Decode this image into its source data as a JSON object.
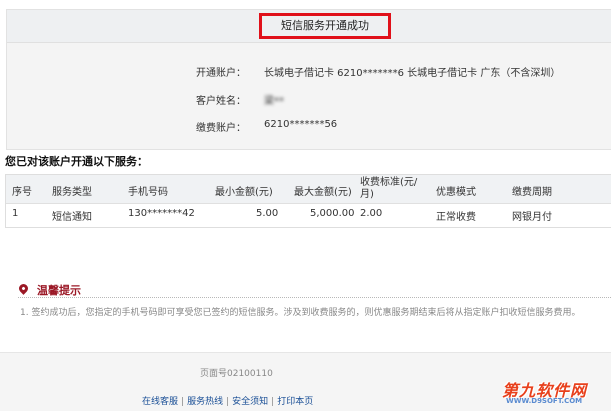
{
  "header": {
    "title": "短信服务开通成功"
  },
  "account_info": {
    "open_account_label": "开通账户：",
    "open_account_value": "长城电子借记卡  6210*******6 长城电子借记卡  广东（不含深圳）",
    "customer_name_label": "客户姓名：",
    "customer_name_value": "梁**",
    "payment_account_label": "缴费账户：",
    "payment_account_value": "6210*******56"
  },
  "services": {
    "heading": "您已对该账户开通以下服务：",
    "columns": [
      "序号",
      "服务类型",
      "手机号码",
      "最小金额(元)",
      "最大金额(元)",
      "收费标准(元/月)",
      "优惠模式",
      "缴费周期"
    ],
    "rows": [
      {
        "index": "1",
        "type": "短信通知",
        "phone": "130*******42",
        "min_amount": "5.00",
        "max_amount": "5,000.00",
        "fee": "2.00",
        "discount": "正常收费",
        "cycle": "网银月付"
      }
    ]
  },
  "tips": {
    "title": "温馨提示",
    "text": "1. 签约成功后，您指定的手机号码即可享受您已签约的短信服务。涉及到收费服务的，则优惠服务期结束后将从指定账户扣收短信服务费用。"
  },
  "footer": {
    "page_number": "页面号02100110",
    "links": [
      "在线客服",
      "服务热线",
      "安全须知",
      "打印本页"
    ]
  },
  "watermark": {
    "main": "第九软件网",
    "url": "WWW.D9SOFT.COM"
  },
  "colors": {
    "highlight_border": "#e0101a",
    "tips_accent": "#9b1826",
    "link": "#1a4f96"
  }
}
